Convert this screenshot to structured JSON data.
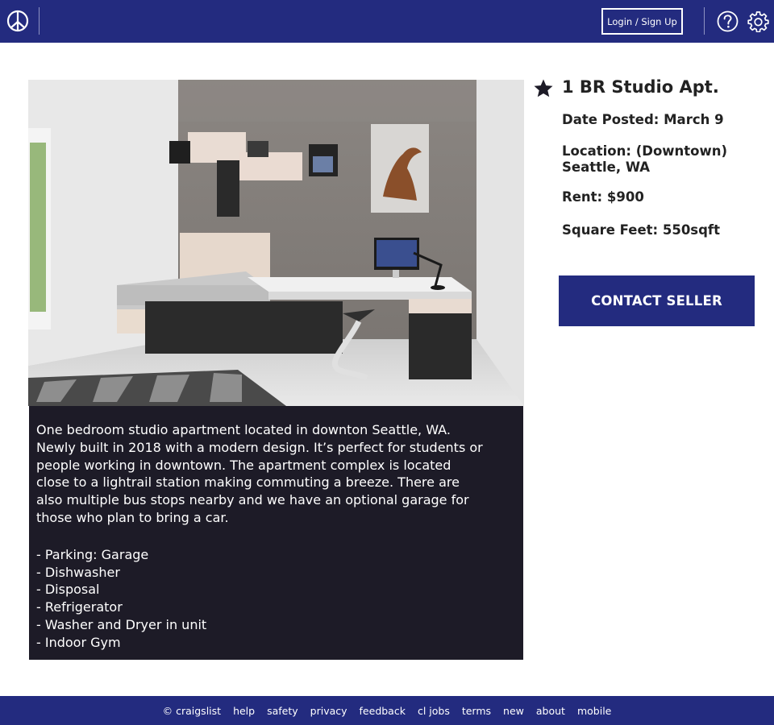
{
  "header": {
    "logo_icon": "peace-sign-icon",
    "login_label": "Login / Sign Up",
    "help_icon": "question-circle-icon",
    "settings_icon": "gear-icon",
    "bg_color": "#232b7f"
  },
  "listing": {
    "photo_icon": "apartment-bedroom-photo",
    "favorite_icon": "star-icon",
    "title": "1 BR Studio Apt.",
    "date_posted": "Date Posted: March 9",
    "location": "Location: (Downtown) Seattle, WA",
    "rent": "Rent: $900",
    "square_feet": "Square Feet: 550sqft",
    "contact_label": "CONTACT SELLER",
    "description": "One bedroom studio apartment located in downton Seattle, WA. Newly built in 2018 with a modern design. It’s perfect for students or people working in downtown. The apartment complex is located close to a lightrail station making commuting a breeze. There are also multiple bus stops nearby and we have an optional garage for those who plan to bring a car.",
    "features": [
      "- Parking: Garage",
      "- Dishwasher",
      "- Disposal",
      "- Refrigerator",
      "- Washer and Dryer in unit",
      "- Indoor Gym"
    ]
  },
  "footer": {
    "links": [
      "© craigslist",
      "help",
      "safety",
      "privacy",
      "feedback",
      "cl jobs",
      "terms",
      "new",
      "about",
      "mobile"
    ]
  }
}
